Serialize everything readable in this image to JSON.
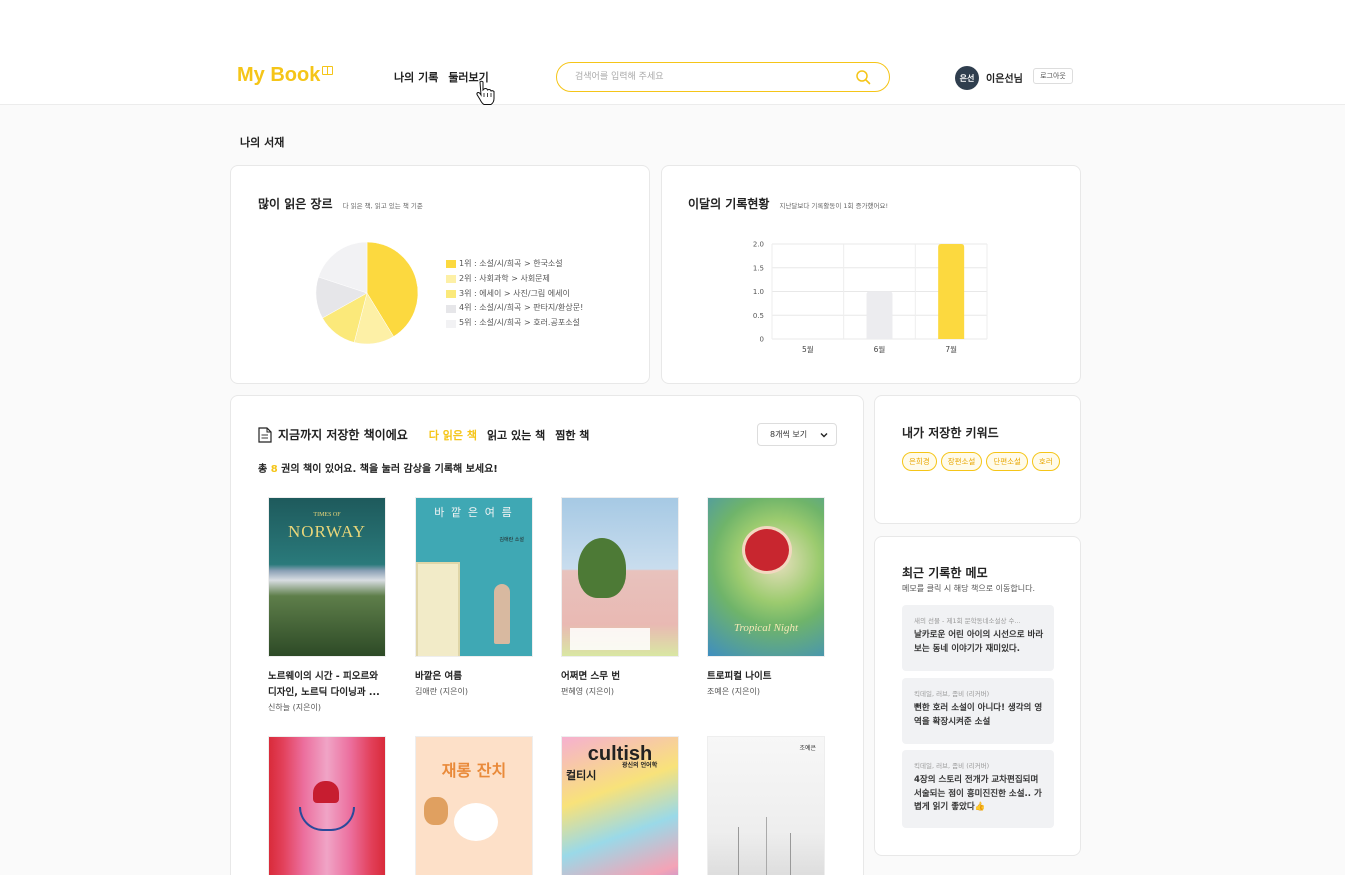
{
  "header": {
    "logo": "My Book",
    "nav": [
      "나의 기록",
      "둘러보기"
    ],
    "search_placeholder": "검색어를 입력해 주세요",
    "avatar_text": "은선",
    "username": "이은선님",
    "logout": "로그아웃"
  },
  "page_title": "나의 서재",
  "genre_card": {
    "title": "많이 읽은 장르",
    "subtitle": "다 읽은 책, 읽고 있는 책 기준",
    "legend": [
      {
        "label": "1위 : 소설/시/희곡 > 한국소설",
        "color": "#fcd93f"
      },
      {
        "label": "2위 : 사회과학 > 사회문제",
        "color": "#fdf0a6"
      },
      {
        "label": "3위 : 에세이 > 사진/그림 에세이",
        "color": "#fbe97a"
      },
      {
        "label": "4위 : 소설/시/희곡 > 판타지/환상문!",
        "color": "#e6e6e9"
      },
      {
        "label": "5위 : 소설/시/희곡 > 호러.공포소설",
        "color": "#f2f2f4"
      }
    ]
  },
  "record_card": {
    "title": "이달의 기록현황",
    "subtitle": "지난달보다 기록활동이 1회 증가했어요!"
  },
  "chart_data": {
    "type": "bar",
    "categories": [
      "5월",
      "6월",
      "7월"
    ],
    "values": [
      0,
      1,
      2
    ],
    "colors": [
      "#ececef",
      "#ececef",
      "#fcd93f"
    ],
    "ylim": [
      0,
      2
    ],
    "yticks": [
      "0",
      "0.5",
      "1.0",
      "1.5",
      "2.0"
    ],
    "grid": true
  },
  "shelf": {
    "title": "지금까지 저장한 책이에요",
    "tabs": [
      "다 읽은 책",
      "읽고 있는 책",
      "찜한 책"
    ],
    "select": "8개씩 보기",
    "count_prefix": "총 ",
    "count": "8",
    "count_suffix": " 권의 책이 있어요. 책을 눌러 감상을 기록해 보세요!",
    "books": [
      {
        "title": "노르웨이의 시간 - 피오르와 디자인, 노르딕 다이닝과 ...",
        "author": "신하늘 (지은이)"
      },
      {
        "title": "바깥은 여름",
        "author": "김애란 (지은이)"
      },
      {
        "title": "어쩌면 스무 번",
        "author": "편혜영 (지은이)"
      },
      {
        "title": "트로피컬 나이트",
        "author": "조예은 (지은이)"
      },
      {
        "title": "",
        "author": ""
      },
      {
        "title": "",
        "author": ""
      },
      {
        "title": "",
        "author": ""
      },
      {
        "title": "",
        "author": ""
      }
    ],
    "cover_texts": {
      "c1_small": "TIMES OF",
      "c1_big": "NORWAY",
      "c2": "바 깥 은   여 름",
      "c2_author": "김애란 소설",
      "c4": "Tropical Night",
      "c6": "재롱 잔치",
      "c7_top": "cultish",
      "c7_ko": "컬티시",
      "c7_sub": "광신의 언어학",
      "c8_top": "조예은"
    }
  },
  "keywords": {
    "title": "내가 저장한 키워드",
    "items": [
      "은희경",
      "장편소설",
      "단편소설",
      "호러"
    ]
  },
  "memos": {
    "title": "최근 기록한 메모",
    "subtitle": "메모를 클릭 시 해당 책으로 이동합니다.",
    "items": [
      {
        "source": "새의 선물 - 제1회 문학동네소설상 수...",
        "text": "날카로운 어린 아이의 시선으로 바라보는 동네 이야기가 재미있다."
      },
      {
        "source": "킥데일, 러브, 좀비 (리커버)",
        "text": "뻔한 호러 소설이 아니다! 생각의 영역을 확장시켜준 소설"
      },
      {
        "source": "킥데일, 러브, 좀비 (리커버)",
        "text": "4장의 스토리 전개가 교차편집되며 서술되는 점이 흥미진진한 소설.. 가볍게 읽기 좋았다👍"
      }
    ]
  }
}
